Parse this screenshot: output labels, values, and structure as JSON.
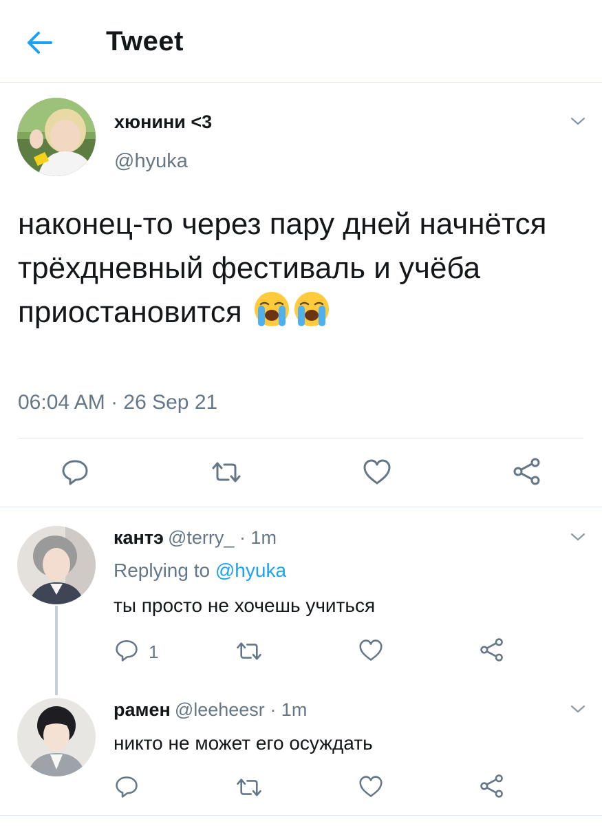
{
  "header": {
    "title": "Tweet",
    "back_icon": "arrow-left-icon",
    "accent": "#1da1f2"
  },
  "main_tweet": {
    "name": "хюнини <3",
    "handle": "@hyuka",
    "text": "наконец-то через пару дней начнётся трёхдневный фестиваль и учёба приостановится",
    "emojis": [
      "loudly-crying-face",
      "loudly-crying-face"
    ],
    "timestamp": "06:04 AM · 26 Sep 21"
  },
  "replies": [
    {
      "name": "кантэ",
      "handle": "@terry_",
      "time": "· 1m",
      "replying_prefix": "Replying to",
      "replying_to": "@hyuka",
      "text": "ты просто не хочешь учиться",
      "reply_count": "1"
    },
    {
      "name": "рамен",
      "handle": "@leeheesr",
      "time": "· 1m",
      "text": "никто не может его осуждать"
    }
  ],
  "colors": {
    "text": "#14171a",
    "muted": "#657786",
    "icon": "#657786",
    "border": "#dfe6ec"
  }
}
